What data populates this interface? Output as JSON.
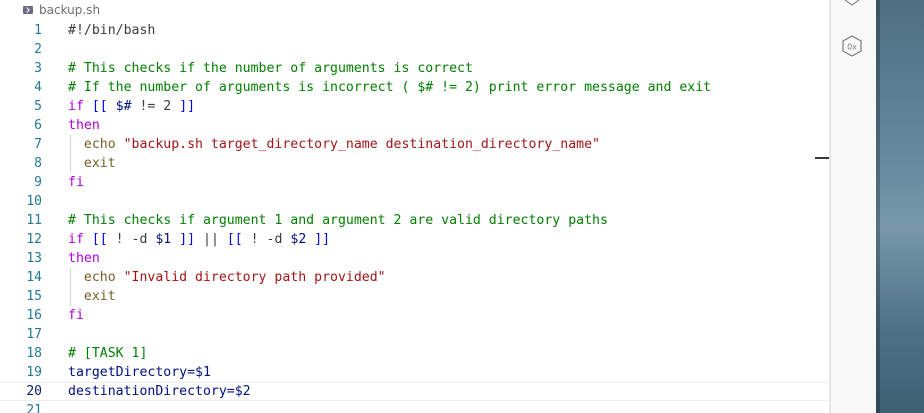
{
  "tab": {
    "filename": "backup.sh",
    "icon": "terminal-file-icon"
  },
  "side_panel": {
    "icon": "hex-0x-icon",
    "label": "0x"
  },
  "lines": [
    {
      "n": "1",
      "tokens": [
        {
          "t": "#!/bin/bash",
          "c": "plain"
        }
      ]
    },
    {
      "n": "2",
      "tokens": []
    },
    {
      "n": "3",
      "tokens": [
        {
          "t": "# This checks if the number of arguments is correct",
          "c": "comment"
        }
      ]
    },
    {
      "n": "4",
      "tokens": [
        {
          "t": "# If the number of arguments is incorrect ( $# != 2) print error message and exit",
          "c": "comment"
        }
      ]
    },
    {
      "n": "5",
      "tokens": [
        {
          "t": "if",
          "c": "keyword"
        },
        {
          "t": " [[ ",
          "c": "kw-blue"
        },
        {
          "t": "$#",
          "c": "var"
        },
        {
          "t": " != 2 ",
          "c": "plain"
        },
        {
          "t": "]]",
          "c": "kw-blue"
        }
      ]
    },
    {
      "n": "6",
      "tokens": [
        {
          "t": "then",
          "c": "keyword"
        }
      ]
    },
    {
      "n": "7",
      "guide": true,
      "tokens": [
        {
          "t": "  echo ",
          "c": "builtin"
        },
        {
          "t": "\"backup.sh target_directory_name destination_directory_name\"",
          "c": "string"
        }
      ]
    },
    {
      "n": "8",
      "guide": true,
      "tokens": [
        {
          "t": "  exit",
          "c": "builtin"
        }
      ]
    },
    {
      "n": "9",
      "tokens": [
        {
          "t": "fi",
          "c": "keyword"
        }
      ]
    },
    {
      "n": "10",
      "tokens": []
    },
    {
      "n": "11",
      "tokens": [
        {
          "t": "# This checks if argument 1 and argument 2 are valid directory paths",
          "c": "comment"
        }
      ]
    },
    {
      "n": "12",
      "tokens": [
        {
          "t": "if",
          "c": "keyword"
        },
        {
          "t": " [[ ",
          "c": "kw-blue"
        },
        {
          "t": "! -d ",
          "c": "plain"
        },
        {
          "t": "$1",
          "c": "var"
        },
        {
          "t": " ]] ",
          "c": "kw-blue"
        },
        {
          "t": "||",
          "c": "plain"
        },
        {
          "t": " [[ ",
          "c": "kw-blue"
        },
        {
          "t": "! -d ",
          "c": "plain"
        },
        {
          "t": "$2",
          "c": "var"
        },
        {
          "t": " ]]",
          "c": "kw-blue"
        }
      ]
    },
    {
      "n": "13",
      "tokens": [
        {
          "t": "then",
          "c": "keyword"
        }
      ]
    },
    {
      "n": "14",
      "guide": true,
      "tokens": [
        {
          "t": "  echo ",
          "c": "builtin"
        },
        {
          "t": "\"Invalid directory path provided\"",
          "c": "string"
        }
      ]
    },
    {
      "n": "15",
      "guide": true,
      "tokens": [
        {
          "t": "  exit",
          "c": "builtin"
        }
      ]
    },
    {
      "n": "16",
      "tokens": [
        {
          "t": "fi",
          "c": "keyword"
        }
      ]
    },
    {
      "n": "17",
      "tokens": []
    },
    {
      "n": "18",
      "tokens": [
        {
          "t": "# [TASK 1]",
          "c": "comment"
        }
      ]
    },
    {
      "n": "19",
      "tokens": [
        {
          "t": "targetDirectory=",
          "c": "var"
        },
        {
          "t": "$1",
          "c": "var"
        }
      ]
    },
    {
      "n": "20",
      "current": true,
      "tokens": [
        {
          "t": "destinationDirectory=",
          "c": "var"
        },
        {
          "t": "$2",
          "c": "var"
        }
      ]
    },
    {
      "n": "21",
      "tokens": []
    }
  ]
}
